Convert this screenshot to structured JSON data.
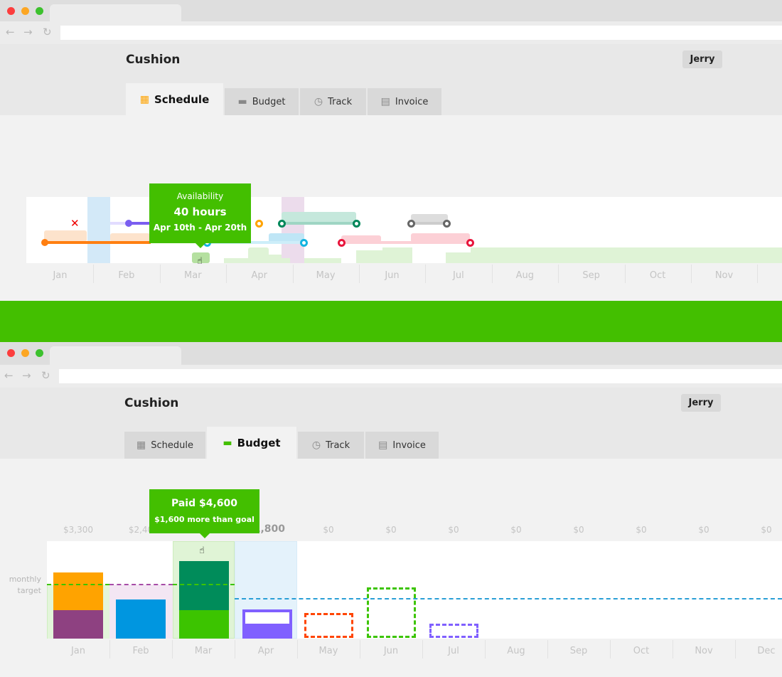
{
  "app": {
    "name": "Cushion",
    "user": "Jerry"
  },
  "tabs": [
    {
      "label": "Schedule",
      "icon": "calendar-icon"
    },
    {
      "label": "Budget",
      "icon": "money-icon"
    },
    {
      "label": "Track",
      "icon": "stopwatch-icon"
    },
    {
      "label": "Invoice",
      "icon": "invoice-icon"
    }
  ],
  "months": [
    "Jan",
    "Feb",
    "Mar",
    "Apr",
    "May",
    "Jun",
    "Jul",
    "Aug",
    "Sep",
    "Oct",
    "Nov",
    "Dec"
  ],
  "schedule": {
    "active_tab": "Schedule",
    "tooltip": {
      "title": "Availability",
      "value": "40 hours",
      "range": "Apr 10th - Apr 20th"
    }
  },
  "budget": {
    "active_tab": "Budget",
    "month_totals": [
      "$3,300",
      "$2,40",
      "",
      "$1,800",
      "$0",
      "$0",
      "$0",
      "$0",
      "$0",
      "$0",
      "$0",
      "$0"
    ],
    "target_label": "monthly target",
    "tooltip": {
      "title": "Paid $4,600",
      "subtitle": "$1,600 more than goal"
    }
  },
  "colors": {
    "accent": "#43bf00",
    "orange": "#ffa300",
    "purple": "#8e4181",
    "blue": "#0096e0",
    "dark_green": "#008c5a",
    "violet": "#8060ff",
    "red": "#ff4500"
  },
  "banner_color": "#43bf00"
}
